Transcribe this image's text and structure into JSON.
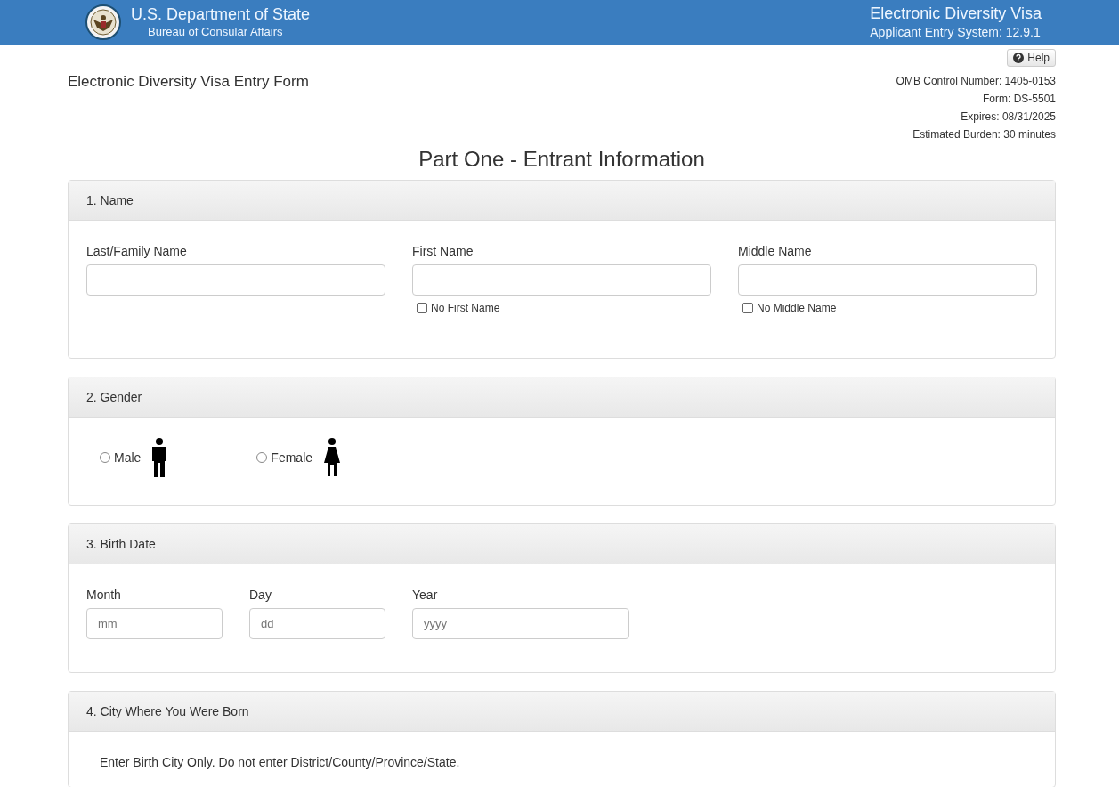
{
  "header": {
    "title": "U.S. Department of State",
    "subtitle": "Bureau of Consular Affairs",
    "system_title": "Electronic Diversity Visa",
    "system_version": "Applicant Entry System: 12.9.1"
  },
  "help_button": "Help",
  "form_title": "Electronic Diversity Visa Entry Form",
  "form_info": [
    "OMB Control Number: 1405-0153",
    "Form: DS-5501",
    "Expires: 08/31/2025",
    "Estimated Burden: 30 minutes"
  ],
  "part_title": "Part One - Entrant Information",
  "sections": [
    {
      "kind": "names",
      "heading": "1. Name",
      "fields": [
        {
          "label": "Last/Family Name"
        },
        {
          "label": "First Name",
          "checkbox": {
            "label": "No First Name",
            "checked": false
          }
        },
        {
          "label": "Middle Name",
          "checkbox": {
            "label": "No Middle Name",
            "checked": false
          }
        }
      ]
    },
    {
      "kind": "gender",
      "heading": "2. Gender",
      "options": [
        {
          "label": "Male",
          "kind": "male",
          "selected": false
        },
        {
          "label": "Female",
          "kind": "female",
          "selected": false
        }
      ]
    },
    {
      "kind": "date",
      "heading": "3. Birth Date",
      "fields": [
        {
          "label": "Month",
          "placeholder": "mm"
        },
        {
          "label": "Day",
          "placeholder": "dd"
        },
        {
          "label": "Year",
          "placeholder": "yyyy"
        }
      ]
    },
    {
      "kind": "note",
      "heading": "4. City Where You Were Born",
      "note": "Enter Birth City Only. Do not enter District/County/Province/State."
    }
  ]
}
